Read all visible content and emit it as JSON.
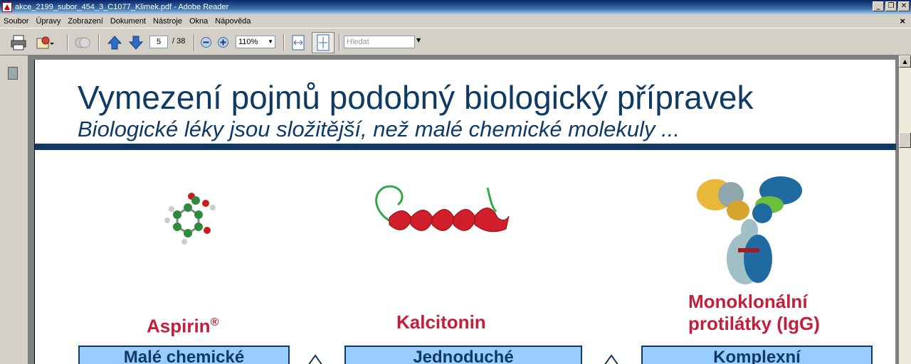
{
  "window": {
    "title": "akce_2199_subor_454_3_C1077_Klimek.pdf - Adobe Reader",
    "buttons": {
      "minimize": "_",
      "restore": "❐",
      "close": "✕"
    }
  },
  "menu": {
    "items": [
      "Soubor",
      "Úpravy",
      "Zobrazení",
      "Dokument",
      "Nástroje",
      "Okna",
      "Nápověda"
    ],
    "close_doc": "×"
  },
  "toolbar": {
    "page_current": "5",
    "page_total": "/ 38",
    "zoom": "110%",
    "search_placeholder": "Hledat",
    "colors": {
      "arrow": "#2c6cc4"
    }
  },
  "slide": {
    "title": "Vymezení pojmů podobný biologický přípravek",
    "subtitle": "Biologické léky jsou složitější, než malé chemické molekuly ...",
    "captions": {
      "aspirin": "Aspirin",
      "aspirin_mark": "®",
      "kalcitonin": "Kalcitonin",
      "mab_line1": "Monoklonální",
      "mab_line2": "protilátky (IgG)"
    },
    "boxes": [
      "Malé chemické",
      "Jednoduché",
      "Komplexní"
    ],
    "colors": {
      "title": "#0e3a63",
      "caption": "#c41e3a",
      "box": "#99ccff"
    }
  }
}
